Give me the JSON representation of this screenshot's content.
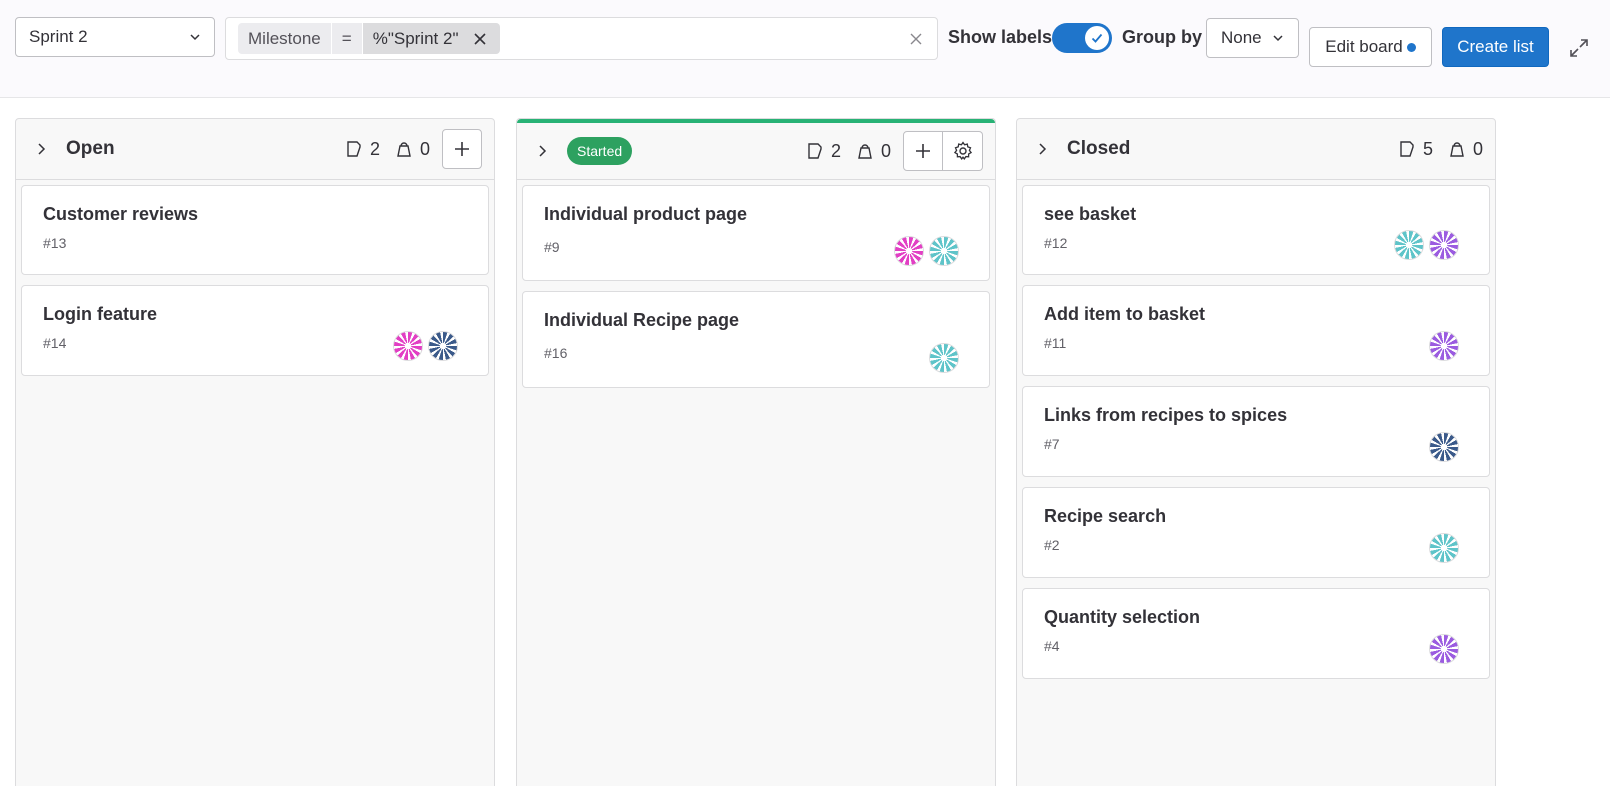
{
  "toolbar": {
    "sprint_select": "Sprint 2",
    "filter": {
      "field": "Milestone",
      "operator": "=",
      "value": "%\"Sprint 2\""
    },
    "show_labels": "Show labels",
    "show_labels_on": true,
    "group_by_label": "Group by",
    "group_by_value": "None",
    "edit_board": "Edit board",
    "create_list": "Create list"
  },
  "columns": [
    {
      "title": "Open",
      "issues": "2",
      "weight": "0",
      "cards": [
        {
          "title": "Customer reviews",
          "num": "#13",
          "avatars": []
        },
        {
          "title": "Login feature",
          "num": "#14",
          "avatars": [
            "pink",
            "navy"
          ]
        }
      ]
    },
    {
      "title": "Started",
      "issues": "2",
      "weight": "0",
      "cards": [
        {
          "title": "Individual product page",
          "num": "#9",
          "avatars": [
            "pink",
            "teal"
          ]
        },
        {
          "title": "Individual Recipe page",
          "num": "#16",
          "avatars": [
            "teal"
          ]
        }
      ]
    },
    {
      "title": "Closed",
      "issues": "5",
      "weight": "0",
      "cards": [
        {
          "title": "see basket",
          "num": "#12",
          "avatars": [
            "teal",
            "purple"
          ]
        },
        {
          "title": "Add item to basket",
          "num": "#11",
          "avatars": [
            "purple"
          ]
        },
        {
          "title": "Links from recipes to spices",
          "num": "#7",
          "avatars": [
            "navy"
          ]
        },
        {
          "title": "Recipe search",
          "num": "#2",
          "avatars": [
            "teal"
          ]
        },
        {
          "title": "Quantity selection",
          "num": "#4",
          "avatars": [
            "purple"
          ]
        }
      ]
    }
  ],
  "colors": {
    "accent": "#1f75cb",
    "started": "#2da160",
    "avatar_pink": "#e23fc4",
    "avatar_teal": "#5fc4c9",
    "avatar_navy": "#3b5a8a",
    "avatar_purple": "#9b5ce0"
  }
}
